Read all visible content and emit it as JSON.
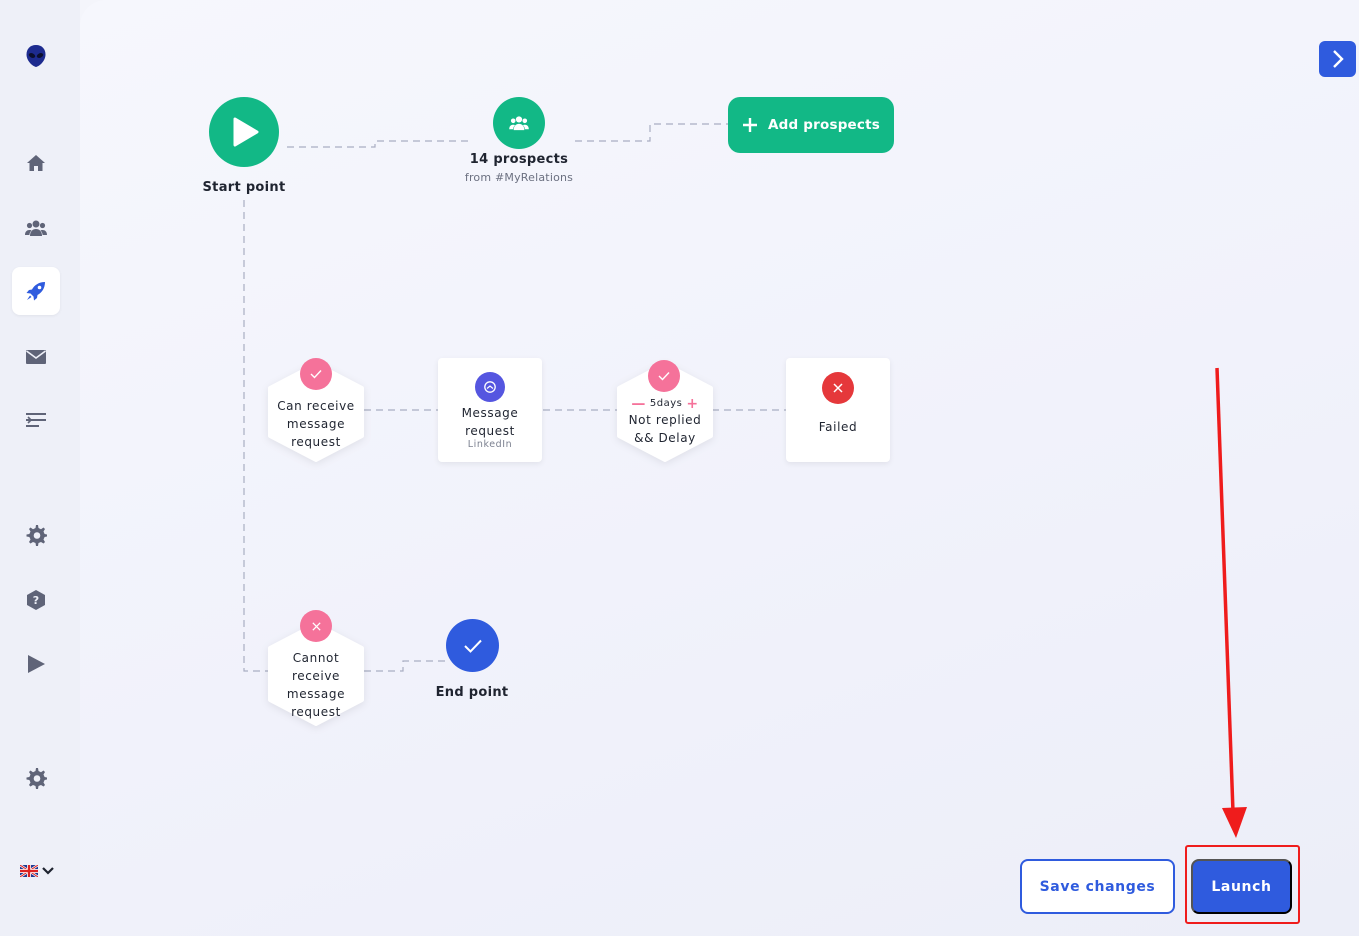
{
  "sidebar": {
    "items": [
      {
        "name": "logo",
        "icon": "alien-logo-icon"
      },
      {
        "name": "home",
        "icon": "home-icon"
      },
      {
        "name": "contacts",
        "icon": "users-icon"
      },
      {
        "name": "campaigns",
        "icon": "rocket-icon",
        "active": true
      },
      {
        "name": "messages",
        "icon": "envelope-icon"
      },
      {
        "name": "sequences",
        "icon": "list-icon"
      },
      {
        "name": "settings",
        "icon": "gear-icon"
      },
      {
        "name": "help",
        "icon": "help-hexagon-icon"
      },
      {
        "name": "tutorials",
        "icon": "play-icon"
      },
      {
        "name": "preferences",
        "icon": "gear-icon"
      }
    ],
    "language": {
      "flag": "uk-flag-icon",
      "chevron": "chevron-down-icon"
    }
  },
  "workflow": {
    "start": {
      "label": "Start point"
    },
    "prospects": {
      "count_label": "14 prospects",
      "source_label": "from #MyRelations"
    },
    "add_prospects": {
      "label": "Add prospects"
    },
    "can_receive": {
      "label_line1": "Can receive",
      "label_line2": "message",
      "label_line3": "request"
    },
    "message_request": {
      "label_line1": "Message",
      "label_line2": "request",
      "channel": "LinkedIn"
    },
    "not_replied": {
      "delay_value": "5days",
      "label_line1": "Not replied",
      "label_line2": "&& Delay"
    },
    "failed": {
      "label": "Failed"
    },
    "cannot_receive": {
      "label_line1": "Cannot",
      "label_line2": "receive",
      "label_line3": "message",
      "label_line4": "request"
    },
    "end": {
      "label": "End point"
    }
  },
  "actions": {
    "save_label": "Save changes",
    "launch_label": "Launch"
  },
  "colors": {
    "green": "#12b886",
    "blue": "#2f5bde",
    "pink": "#f5729a",
    "red": "#e5383b",
    "purple": "#5556e0",
    "annotation_red": "#ef1c1c"
  }
}
